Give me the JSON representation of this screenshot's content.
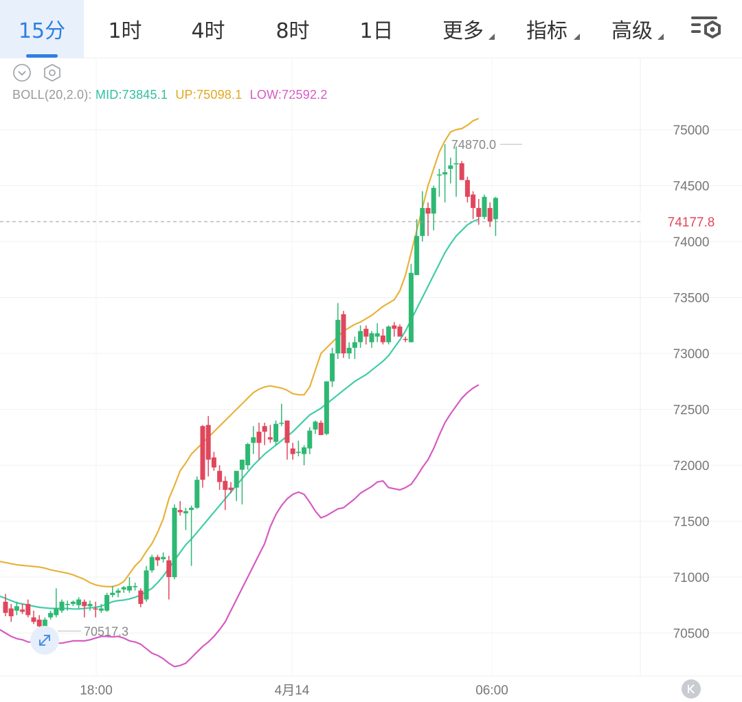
{
  "tabs": [
    {
      "label": "15分",
      "active": true
    },
    {
      "label": "1时"
    },
    {
      "label": "4时"
    },
    {
      "label": "8时"
    },
    {
      "label": "1日"
    },
    {
      "label": "更多",
      "dropdown": true
    },
    {
      "label": "指标",
      "dropdown": true
    },
    {
      "label": "高级",
      "dropdown": true
    }
  ],
  "settings_icon": "chart-settings-icon",
  "tools": {
    "collapse_icon": "chevron-down-circle-icon",
    "settings_icon": "hexagon-settings-icon"
  },
  "indicator": {
    "name": "BOLL(20,2.0):",
    "mid": "MID:73845.1",
    "up": "UP:75098.1",
    "low": "LOW:72592.2"
  },
  "colors": {
    "up_candle": "#2eb872",
    "down_candle": "#e0475c",
    "mid_line": "#3fcca8",
    "upper_line": "#e8b23a",
    "lower_line": "#d65ac2",
    "price_label": "#e0475c",
    "active_tab": "#2f7fe0"
  },
  "chart_data": {
    "type": "candlestick",
    "y_axis_ticks": [
      "75000",
      "74500",
      "74000",
      "73500",
      "73000",
      "72500",
      "72000",
      "71500",
      "71000",
      "70500"
    ],
    "x_axis_ticks": [
      "18:00",
      "4月14",
      "06:00"
    ],
    "last_price": "74177.8",
    "max_label": "74870.0",
    "min_label": "70517.3",
    "ohlc": [
      [
        70780,
        70850,
        70650,
        70680
      ],
      [
        70720,
        70760,
        70600,
        70650
      ],
      [
        70700,
        70780,
        70660,
        70740
      ],
      [
        70710,
        70760,
        70670,
        70690
      ],
      [
        70760,
        70800,
        70640,
        70660
      ],
      [
        70640,
        70700,
        70580,
        70600
      ],
      [
        70620,
        70660,
        70540,
        70560
      ],
      [
        70560,
        70640,
        70520,
        70620
      ],
      [
        70640,
        70700,
        70620,
        70680
      ],
      [
        70660,
        70900,
        70640,
        70720
      ],
      [
        70700,
        70800,
        70680,
        70780
      ],
      [
        70750,
        70790,
        70700,
        70760
      ],
      [
        70760,
        70790,
        70740,
        70780
      ],
      [
        70750,
        70820,
        70720,
        70800
      ],
      [
        70780,
        70800,
        70640,
        70740
      ],
      [
        70740,
        70790,
        70700,
        70760
      ],
      [
        70720,
        70780,
        70640,
        70710
      ],
      [
        70700,
        70760,
        70680,
        70720
      ],
      [
        70700,
        70860,
        70690,
        70840
      ],
      [
        70840,
        70920,
        70820,
        70860
      ],
      [
        70860,
        70900,
        70820,
        70880
      ],
      [
        70890,
        70920,
        70860,
        70910
      ],
      [
        70880,
        71000,
        70860,
        70920
      ],
      [
        70910,
        70950,
        70880,
        70920
      ],
      [
        70880,
        70900,
        70730,
        70760
      ],
      [
        70800,
        71100,
        70780,
        71060
      ],
      [
        71060,
        71200,
        71040,
        71180
      ],
      [
        71180,
        71200,
        71100,
        71150
      ],
      [
        71160,
        71220,
        71130,
        71180
      ],
      [
        71150,
        71190,
        70800,
        71000
      ],
      [
        71000,
        71650,
        70980,
        71620
      ],
      [
        71600,
        71680,
        71550,
        71580
      ],
      [
        71570,
        71620,
        71420,
        71590
      ],
      [
        71600,
        71640,
        71100,
        71620
      ],
      [
        71620,
        71900,
        71610,
        71870
      ],
      [
        72350,
        72360,
        71800,
        71870
      ],
      [
        72360,
        72440,
        71900,
        72050
      ],
      [
        72070,
        72120,
        71950,
        71980
      ],
      [
        71950,
        72000,
        71780,
        71850
      ],
      [
        71860,
        71900,
        71600,
        71780
      ],
      [
        71800,
        71850,
        71750,
        71780
      ],
      [
        71800,
        71850,
        71680,
        71950
      ],
      [
        71960,
        72050,
        71650,
        72050
      ],
      [
        72000,
        72200,
        71960,
        72190
      ],
      [
        72200,
        72350,
        72100,
        72250
      ],
      [
        72300,
        72380,
        72050,
        72200
      ],
      [
        72350,
        72380,
        72180,
        72300
      ],
      [
        72250,
        72360,
        72200,
        72230
      ],
      [
        72210,
        72400,
        72180,
        72370
      ],
      [
        72380,
        72550,
        72350,
        72380
      ],
      [
        72400,
        72400,
        72050,
        72200
      ],
      [
        72150,
        72200,
        72050,
        72100
      ],
      [
        72110,
        72220,
        72080,
        72120
      ],
      [
        72100,
        72180,
        72000,
        72160
      ],
      [
        72150,
        72340,
        72100,
        72310
      ],
      [
        72320,
        72400,
        72280,
        72390
      ],
      [
        72380,
        72400,
        72300,
        72270
      ],
      [
        72280,
        72750,
        72270,
        72750
      ],
      [
        72750,
        73050,
        72700,
        73000
      ],
      [
        73000,
        73450,
        72950,
        73300
      ],
      [
        73350,
        73380,
        72960,
        73000
      ],
      [
        73000,
        73100,
        72950,
        73050
      ],
      [
        73050,
        73150,
        72950,
        73100
      ],
      [
        73100,
        73250,
        73050,
        73200
      ],
      [
        73220,
        73250,
        73080,
        73150
      ],
      [
        73100,
        73200,
        73050,
        73180
      ],
      [
        73150,
        73270,
        73100,
        73180
      ],
      [
        73160,
        73220,
        73080,
        73100
      ],
      [
        73100,
        73250,
        73080,
        73240
      ],
      [
        73250,
        73280,
        73150,
        73220
      ],
      [
        73240,
        73260,
        73150,
        73150
      ],
      [
        73130,
        73150,
        73100,
        73120
      ],
      [
        73100,
        73800,
        73100,
        73720
      ],
      [
        73700,
        74200,
        73700,
        74050
      ],
      [
        74050,
        74450,
        74000,
        74300
      ],
      [
        74300,
        74350,
        74050,
        74250
      ],
      [
        74250,
        74500,
        74100,
        74480
      ],
      [
        74600,
        74650,
        74400,
        74600
      ],
      [
        74600,
        74870,
        74350,
        74620
      ],
      [
        74650,
        74750,
        74520,
        74680
      ],
      [
        74690,
        74850,
        74400,
        74700
      ],
      [
        74700,
        74720,
        74550,
        74550
      ],
      [
        74550,
        74580,
        74350,
        74400
      ],
      [
        74420,
        74450,
        74200,
        74300
      ],
      [
        74300,
        74380,
        74150,
        74220
      ],
      [
        74220,
        74420,
        74200,
        74400
      ],
      [
        74300,
        74350,
        74130,
        74180
      ],
      [
        74200,
        74400,
        74050,
        74390
      ]
    ],
    "boll_mid": [
      70880,
      70850,
      70830,
      70810,
      70790,
      70770,
      70760,
      70750,
      70740,
      70730,
      70725,
      70720,
      70720,
      70720,
      70720,
      70715,
      70715,
      70720,
      70725,
      70730,
      70740,
      70760,
      70780,
      70790,
      70795,
      70805,
      70820,
      70840,
      70870,
      70900,
      70950,
      71010,
      71080,
      71150,
      71220,
      71290,
      71340,
      71400,
      71460,
      71520,
      71580,
      71640,
      71700,
      71760,
      71820,
      71880,
      71940,
      72000,
      72050,
      72100,
      72140,
      72180,
      72220,
      72260,
      72300,
      72350,
      72400,
      72450,
      72480,
      72510,
      72550,
      72590,
      72630,
      72670,
      72710,
      72750,
      72780,
      72810,
      72850,
      72890,
      72930,
      72980,
      73050,
      73120,
      73200,
      73300,
      73400,
      73500,
      73600,
      73700,
      73800,
      73900,
      73980,
      74050,
      74100,
      74150,
      74180,
      74200
    ],
    "boll_up": [
      71170,
      71155,
      71140,
      71130,
      71120,
      71110,
      71105,
      71100,
      71095,
      71090,
      71080,
      71065,
      71055,
      71045,
      71035,
      71020,
      71000,
      70980,
      70950,
      70930,
      70920,
      70915,
      70915,
      70930,
      70960,
      71030,
      71100,
      71150,
      71230,
      71300,
      71400,
      71520,
      71700,
      71820,
      71950,
      72020,
      72100,
      72150,
      72200,
      72250,
      72300,
      72350,
      72400,
      72450,
      72500,
      72550,
      72600,
      72650,
      72680,
      72700,
      72710,
      72700,
      72690,
      72670,
      72640,
      72630,
      72630,
      72700,
      72850,
      73000,
      73050,
      73100,
      73150,
      73200,
      73230,
      73260,
      73280,
      73310,
      73340,
      73380,
      73420,
      73450,
      73480,
      73560,
      73700,
      73900,
      74100,
      74300,
      74500,
      74650,
      74800,
      74900,
      74980,
      75000,
      75010,
      75040,
      75080,
      75100
    ],
    "boll_low": [
      70590,
      70560,
      70530,
      70500,
      70470,
      70450,
      70440,
      70420,
      70420,
      70420,
      70420,
      70410,
      70410,
      70410,
      70420,
      70430,
      70430,
      70430,
      70440,
      70455,
      70470,
      70470,
      70465,
      70470,
      70455,
      70430,
      70420,
      70400,
      70360,
      70320,
      70300,
      70270,
      70230,
      70200,
      70210,
      70230,
      70280,
      70330,
      70380,
      70420,
      70470,
      70530,
      70600,
      70700,
      70800,
      70900,
      71000,
      71100,
      71200,
      71300,
      71450,
      71560,
      71640,
      71700,
      71740,
      71760,
      71740,
      71670,
      71590,
      71530,
      71550,
      71580,
      71610,
      71620,
      71660,
      71700,
      71750,
      71780,
      71810,
      71850,
      71860,
      71800,
      71790,
      71780,
      71800,
      71830,
      71900,
      71980,
      72050,
      72150,
      72270,
      72380,
      72460,
      72530,
      72600,
      72650,
      72690,
      72720
    ],
    "ylim": [
      70200,
      75350
    ]
  }
}
